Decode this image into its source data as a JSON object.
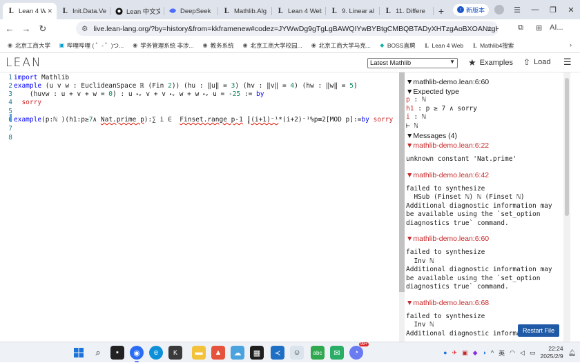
{
  "browser": {
    "tabs": [
      {
        "label": "Lean 4 W",
        "icon": "L",
        "active": true
      },
      {
        "label": "Init.Data.Ve",
        "icon": "L"
      },
      {
        "label": "Lean 中文文",
        "icon": "github-icon"
      },
      {
        "label": "DeepSeek",
        "icon": "deepseek-icon"
      },
      {
        "label": "Mathlib.Alg",
        "icon": "L"
      },
      {
        "label": "Lean 4 Web",
        "icon": "L"
      },
      {
        "label": "9. Linear al",
        "icon": "L"
      },
      {
        "label": "11. Differe",
        "icon": "L"
      }
    ],
    "new_version_label": "新版本",
    "url": "live.lean-lang.org/?by=history&from=kkframenew#codez=JYWwDg9gTgLgBAWQIYwBYBtgCMBQBTADyXHTzgAoBXOANzgHc...",
    "ai_label": "AI...",
    "bookmarks": [
      "北京工商大学",
      "哔哩哔哩 ( ゜- ゜)つ...",
      "学务管理系统 非涉...",
      "教务系统",
      "北京工商大学校园...",
      "北京工商大学马克...",
      "BOSS直聘",
      "Lean 4 Web",
      "Mathlib4搜索"
    ]
  },
  "lean": {
    "logo": "LEAN",
    "version_select": "Latest Mathlib",
    "examples_label": "Examples",
    "load_label": "Load",
    "restart_label": "Restart File"
  },
  "editor": {
    "line_numbers": [
      "1",
      "2",
      "3",
      "4",
      "5",
      "6",
      "7",
      "8"
    ]
  },
  "infoview": {
    "cursor_pos": "mathlib-demo.lean:6:60",
    "expected_type_label": "Expected type",
    "goals": [
      {
        "name": "p",
        "type": ": ℕ"
      },
      {
        "name": "h1",
        "type": ": p ≥ 7 ∧ sorry"
      },
      {
        "name": "i",
        "type": ": ℕ"
      }
    ],
    "goal_target": "⊢ ℕ",
    "messages_label": "Messages (4)",
    "messages": [
      {
        "loc": "mathlib-demo.lean:6:22",
        "text": "unknown constant 'Nat.prime'"
      },
      {
        "loc": "mathlib-demo.lean:6:42",
        "text": "failed to synthesize\n  HSub (Finset ℕ) ℕ (Finset ℕ)\nAdditional diagnostic information may\nbe available using the `set_option\ndiagnostics true` command."
      },
      {
        "loc": "mathlib-demo.lean:6:60",
        "text": "failed to synthesize\n  Inv ℕ\nAdditional diagnostic information may\nbe available using the `set_option\ndiagnostics true` command."
      },
      {
        "loc": "mathlib-demo.lean:6:68",
        "text": "failed to synthesize\n  Inv ℕ\nAdditional diagnostic information may"
      }
    ]
  },
  "taskbar": {
    "lang": "英",
    "time": "22:24",
    "date": "2025/2/9",
    "badge": "99+"
  },
  "colors": {
    "accent": "#1e5aa6",
    "error": "#c82829",
    "keyword": "#0000ff"
  }
}
